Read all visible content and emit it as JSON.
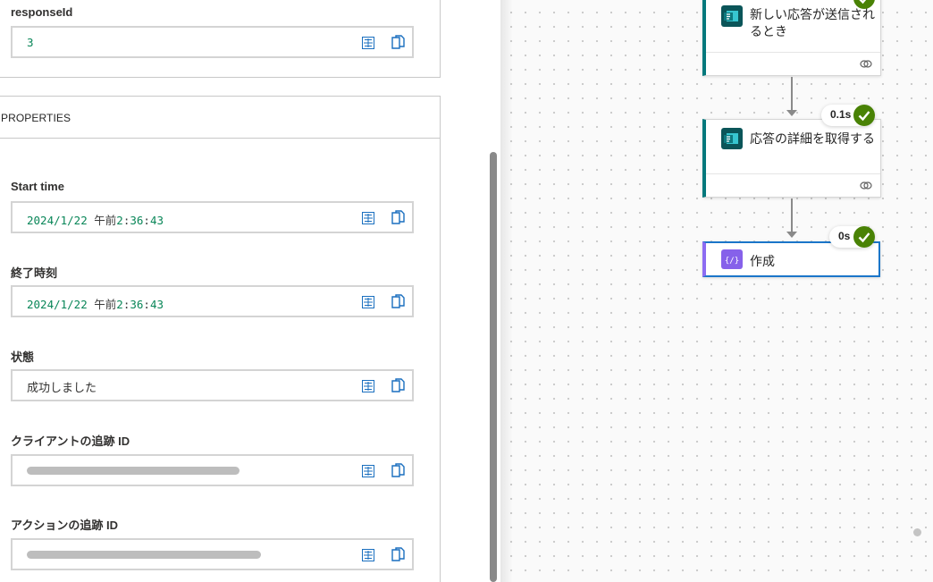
{
  "left_panel": {
    "response_id": {
      "label": "responseId",
      "value": "3"
    },
    "properties_title": "PROPERTIES",
    "start_time": {
      "label": "Start time",
      "date": "2024/1/22",
      "ampm": "午前",
      "time_h": "2",
      "time_m": "36",
      "time_s": "43"
    },
    "end_time": {
      "label": "終了時刻",
      "date": "2024/1/22",
      "ampm": "午前",
      "time_h": "2",
      "time_m": "36",
      "time_s": "43"
    },
    "status": {
      "label": "状態",
      "value": "成功しました"
    },
    "client_tracking_id": {
      "label": "クライアントの追跡 ID",
      "value_redacted": true
    },
    "action_tracking_id": {
      "label": "アクションの追跡 ID",
      "value_redacted": true
    }
  },
  "flow": {
    "trigger": {
      "title": "新しい応答が送信されるとき",
      "icon": "forms-icon"
    },
    "get_details": {
      "title": "応答の詳細を取得する",
      "icon": "forms-icon",
      "duration": "0.1s",
      "status": "succeeded"
    },
    "compose": {
      "title": "作成",
      "icon": "compose-icon",
      "duration": "0s",
      "status": "succeeded"
    }
  },
  "colors": {
    "success": "#498205",
    "forms_accent": "#03787c",
    "compose_accent": "#8c6cf2",
    "selected_border": "#1b76c9",
    "number_value": "#098658"
  }
}
